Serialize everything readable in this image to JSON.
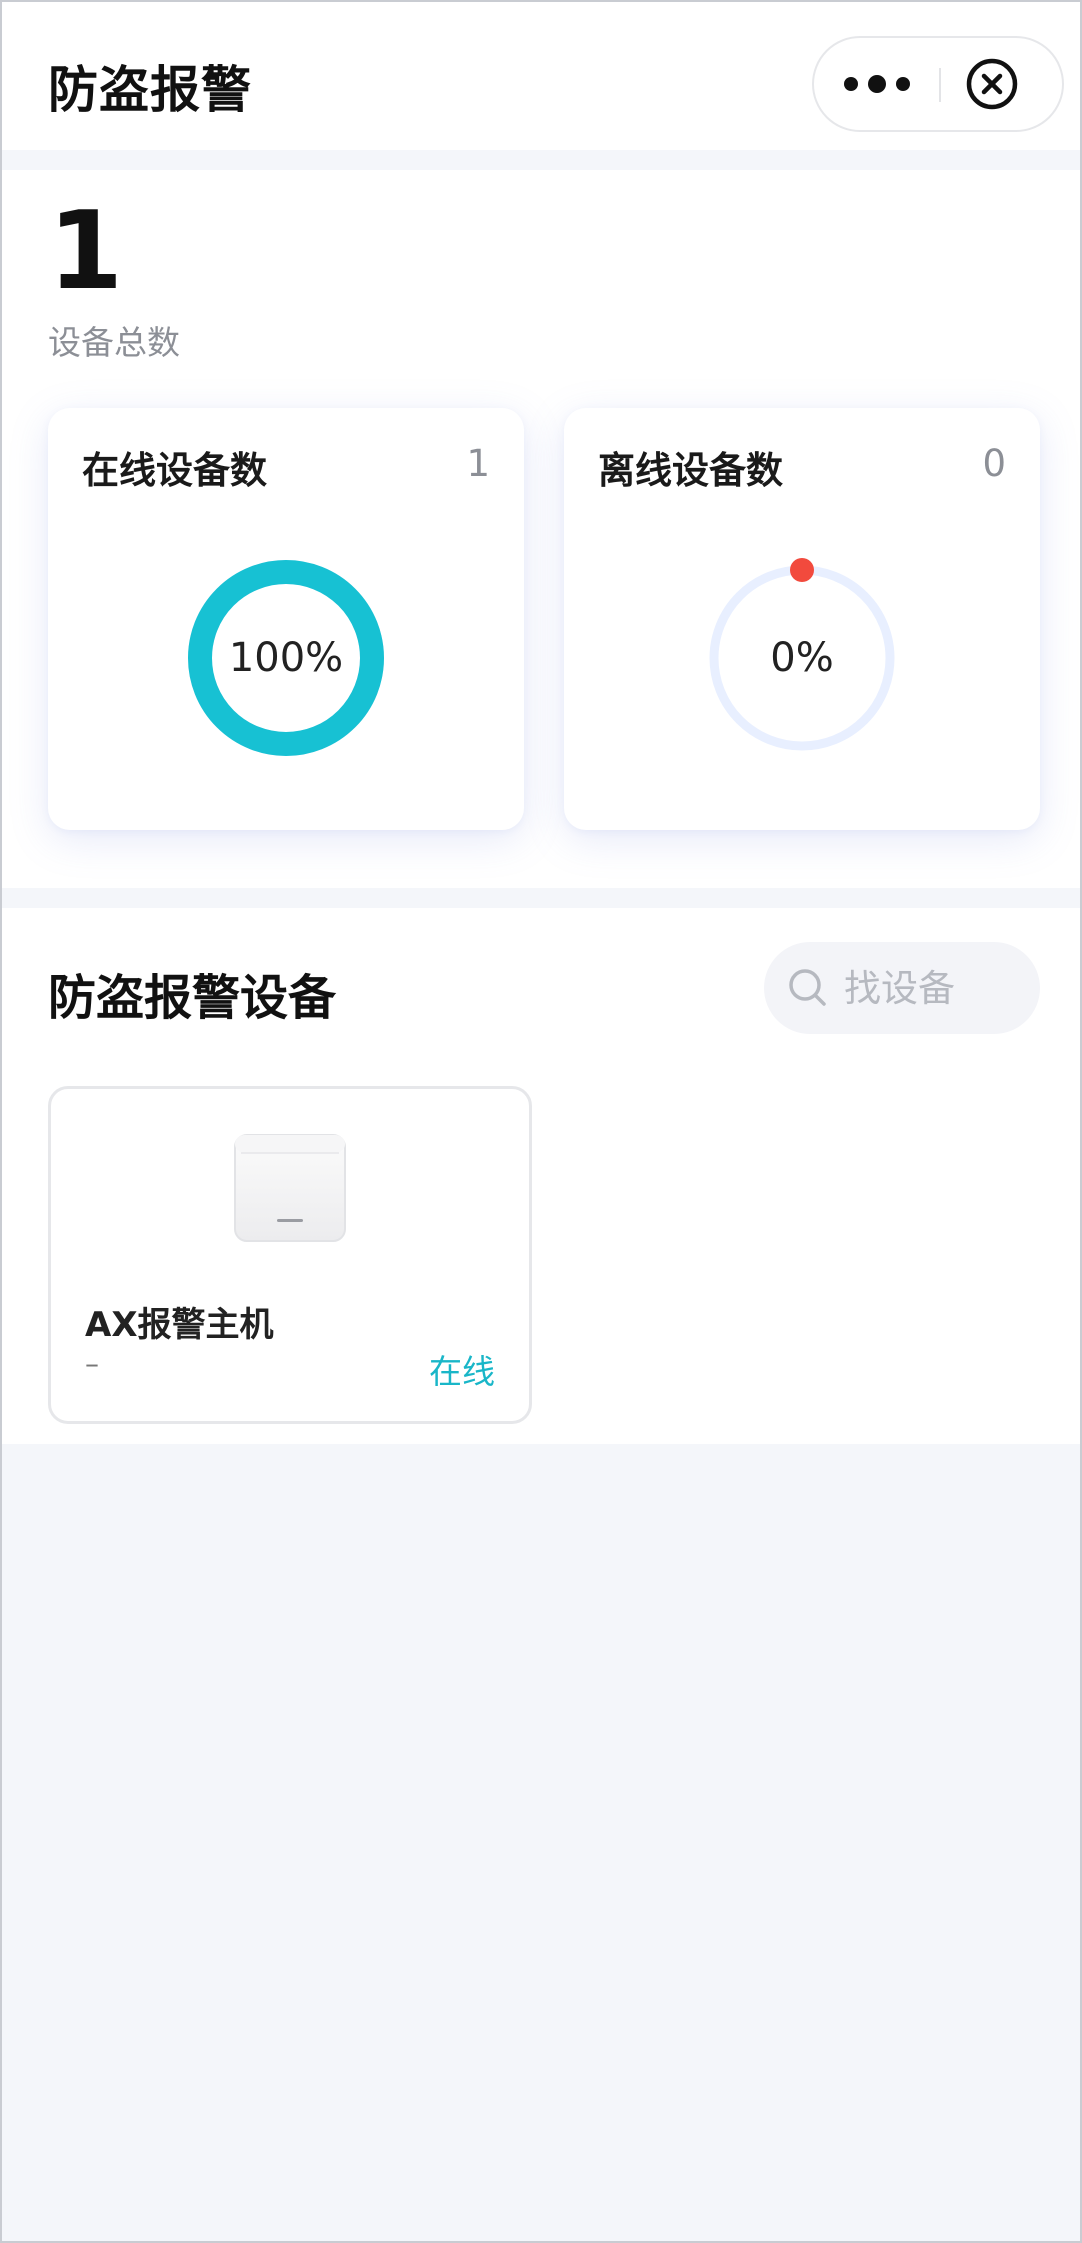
{
  "header": {
    "title": "防盗报警",
    "more_icon": "more-dots-icon",
    "close_icon": "close-circle-icon"
  },
  "summary": {
    "total": "1",
    "total_label": "设备总数",
    "online": {
      "title": "在线设备数",
      "count": "1",
      "percent_label": "100%",
      "fraction": 1.0,
      "color": "#17c1d3"
    },
    "offline": {
      "title": "离线设备数",
      "count": "0",
      "percent_label": "0%",
      "fraction": 0.0,
      "track_color": "#e8efff",
      "dot_color": "#f24a3d"
    }
  },
  "devices": {
    "title": "防盗报警设备",
    "search_placeholder": "找设备",
    "items": [
      {
        "name": "AX报警主机",
        "sub": "–",
        "status": "在线",
        "status_color": "#19b6c8",
        "image": "alarm-host-device-image"
      }
    ]
  }
}
